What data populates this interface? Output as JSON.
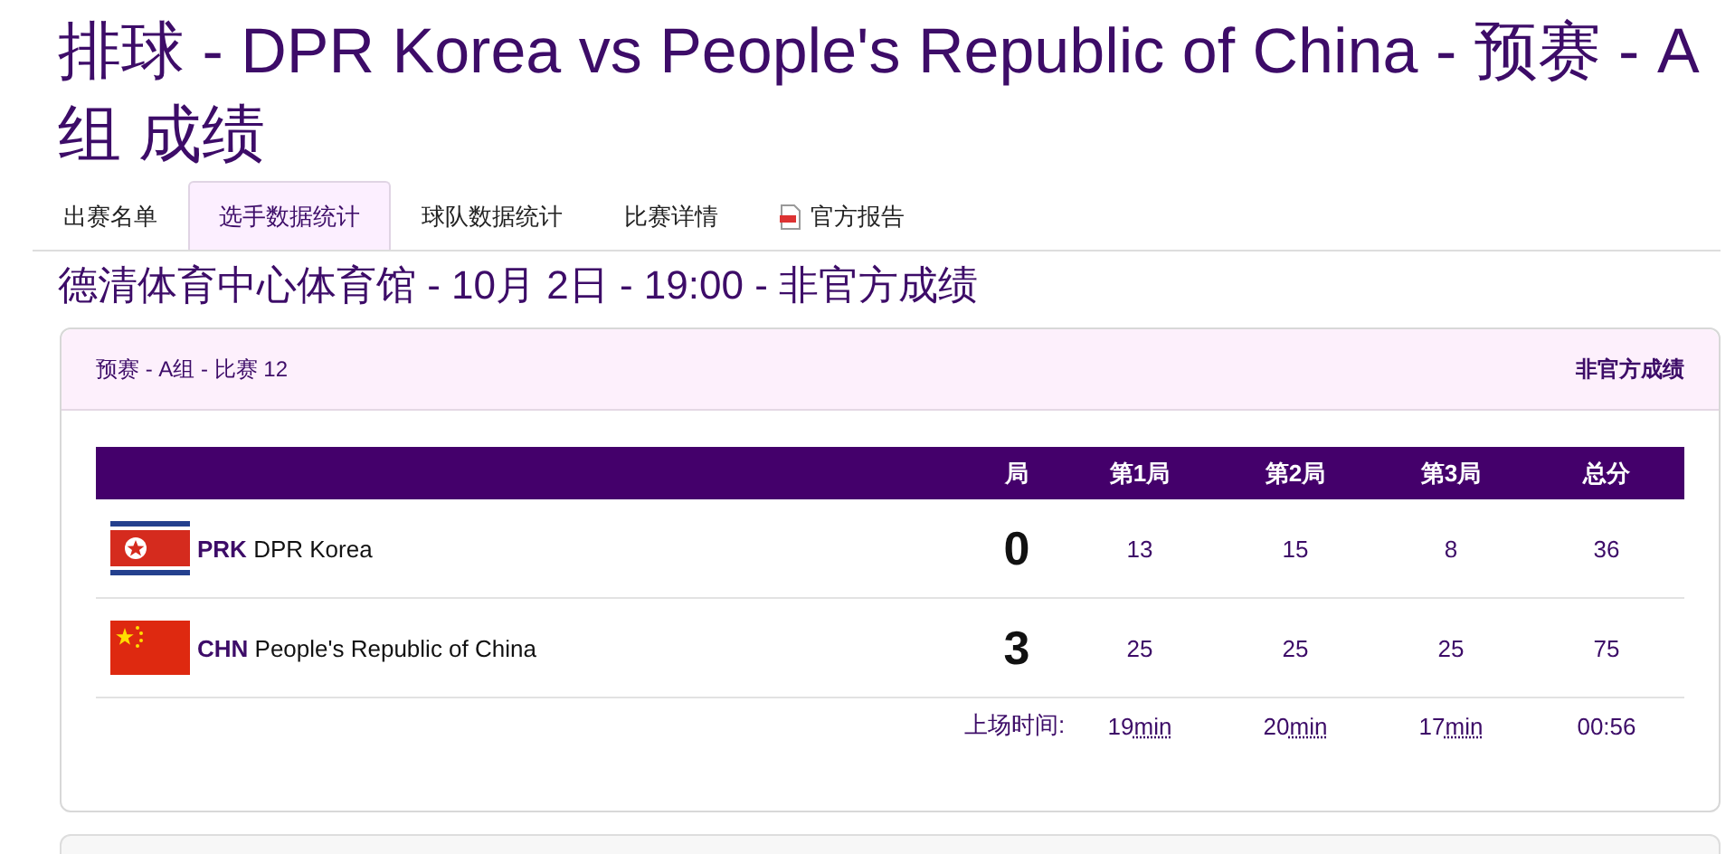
{
  "title": "排球 - DPR Korea vs People's Republic of China - 预赛 - A组 成绩",
  "tabs": [
    {
      "label": "出赛名单",
      "selected": false,
      "kind": "text"
    },
    {
      "label": "选手数据统计",
      "selected": true,
      "kind": "text"
    },
    {
      "label": "球队数据统计",
      "selected": false,
      "kind": "text"
    },
    {
      "label": "比赛详情",
      "selected": false,
      "kind": "text"
    },
    {
      "label": "官方报告",
      "selected": false,
      "kind": "pdf"
    }
  ],
  "venue": "德清体育中心体育馆 - 10月 2日 - 19:00 - 非官方成绩",
  "card": {
    "phase": "预赛 - A组  - 比赛 12",
    "status": "非官方成绩",
    "columns": [
      "局",
      "第1局",
      "第2局",
      "第3局",
      "总分"
    ],
    "rows": [
      {
        "kind": "prk",
        "code": "PRK",
        "name": "DPR Korea",
        "sets": "0",
        "scores": [
          "13",
          "15",
          "8",
          "36"
        ]
      },
      {
        "kind": "chn",
        "code": "CHN",
        "name": "People's Republic of China",
        "sets": "3",
        "scores": [
          "25",
          "25",
          "25",
          "75"
        ]
      }
    ],
    "duration_label": "上场时间:",
    "durations": [
      {
        "value": "19",
        "unit": "min"
      },
      {
        "value": "20",
        "unit": "min"
      },
      {
        "value": "17",
        "unit": "min"
      },
      {
        "value": "00:56"
      }
    ]
  }
}
